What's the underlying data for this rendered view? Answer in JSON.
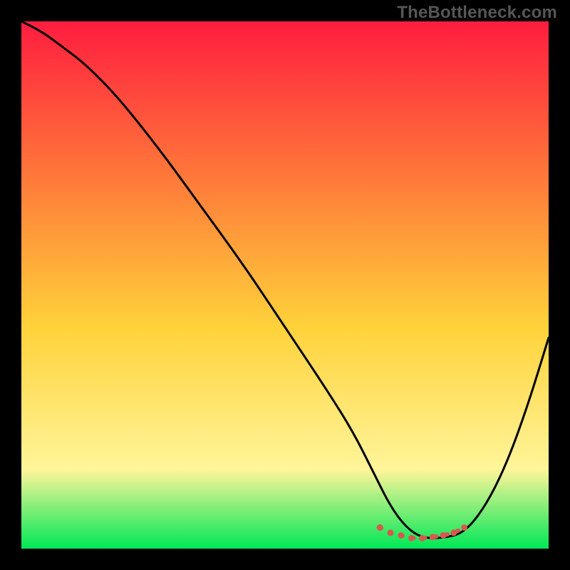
{
  "watermark": "TheBottleneck.com",
  "colors": {
    "background": "#000000",
    "gradient_top": "#ff1d3f",
    "gradient_mid_upper": "#ff7a3a",
    "gradient_mid": "#ffd23a",
    "gradient_mid_lower": "#fff59a",
    "gradient_bottom": "#00e756",
    "curve": "#000000",
    "marker": "#d8584f"
  },
  "chart_data": {
    "type": "line",
    "title": "",
    "xlabel": "",
    "ylabel": "",
    "xlim": [
      0,
      100
    ],
    "ylim": [
      0,
      100
    ],
    "series": [
      {
        "name": "bottleneck-curve",
        "x": [
          0,
          4,
          8,
          12,
          18,
          26,
          34,
          42,
          50,
          58,
          63,
          67,
          70,
          73,
          76,
          80,
          84,
          88,
          92,
          96,
          100
        ],
        "y": [
          100,
          98,
          95,
          92,
          86,
          76,
          65,
          54,
          42,
          30,
          22,
          14,
          8,
          4,
          2,
          2,
          3,
          8,
          16,
          27,
          40
        ]
      }
    ],
    "markers": {
      "name": "optimal-range",
      "x": [
        68,
        70,
        72,
        74,
        76,
        78,
        80,
        82,
        84
      ],
      "y": [
        4,
        3,
        2.5,
        2,
        2,
        2.2,
        2.5,
        3,
        4
      ]
    }
  }
}
